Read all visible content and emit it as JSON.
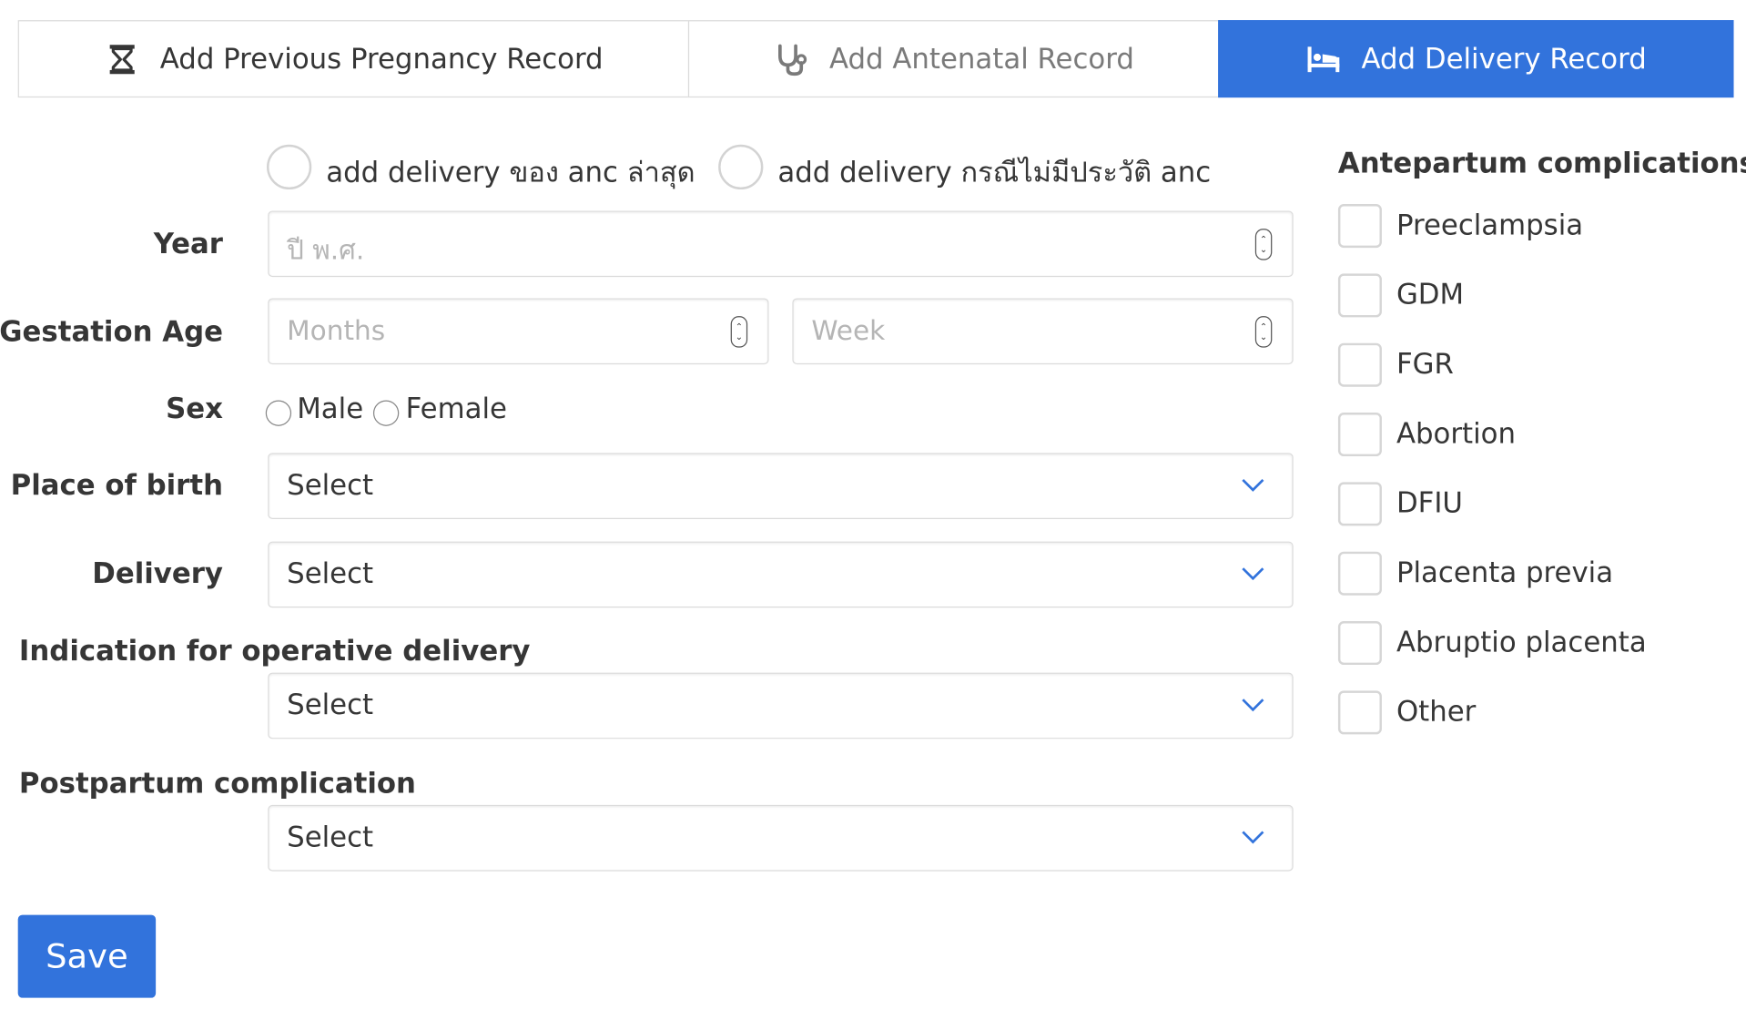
{
  "tabs": [
    {
      "label": "Add Previous Pregnancy Record",
      "icon": "hourglass-icon"
    },
    {
      "label": "Add Antenatal Record",
      "icon": "stethoscope-icon"
    },
    {
      "label": "Add Delivery Record",
      "icon": "bed-icon"
    }
  ],
  "active_tab": "Add Delivery Record",
  "accent_color": "#3273dc",
  "delivery_mode": {
    "option_latest_anc": "add delivery ของ anc ล่าสุด",
    "option_no_anc": "add delivery กรณีไม่มีประวัติ anc"
  },
  "form": {
    "year": {
      "label": "Year",
      "placeholder": "ปี พ.ศ."
    },
    "gestation_age": {
      "label": "Gestation Age",
      "months_placeholder": "Months",
      "week_placeholder": "Week"
    },
    "sex": {
      "label": "Sex",
      "options": [
        "Male",
        "Female"
      ]
    },
    "place_of_birth": {
      "label": "Place of birth",
      "value": "Select"
    },
    "delivery": {
      "label": "Delivery",
      "value": "Select"
    },
    "indication": {
      "label": "Indication for operative delivery",
      "value": "Select"
    },
    "postpartum": {
      "label": "Postpartum complication",
      "value": "Select"
    }
  },
  "antepartum": {
    "title": "Antepartum complications",
    "items": [
      "Preeclampsia",
      "GDM",
      "FGR",
      "Abortion",
      "DFIU",
      "Placenta previa",
      "Abruptio placenta",
      "Other"
    ]
  },
  "save_label": "Save"
}
